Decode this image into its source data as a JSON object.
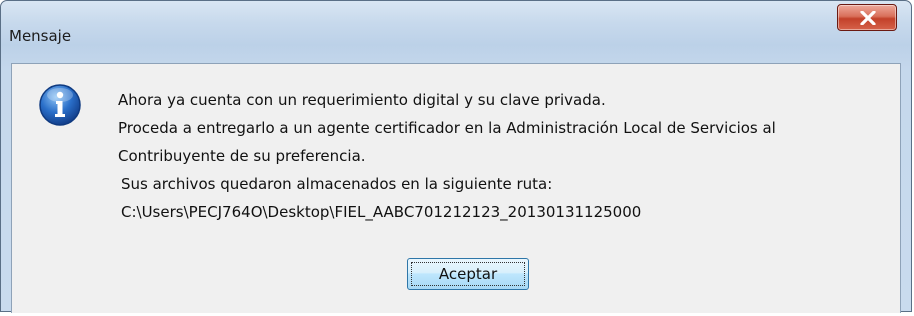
{
  "window": {
    "title": "Mensaje",
    "close_icon": "close-x-icon"
  },
  "message": {
    "icon": "information-icon",
    "lines": [
      "Ahora ya cuenta con un requerimiento digital y su clave privada.",
      "Proceda a entregarlo a un agente certificador en la Administración Local de Servicios al",
      "Contribuyente de su preferencia.",
      "Sus archivos quedaron almacenados en la siguiente ruta:",
      "C:\\Users\\PECJ764O\\Desktop\\FIEL_AABC701212123_20130131125000"
    ]
  },
  "buttons": {
    "ok_label": "Aceptar"
  },
  "colors": {
    "close_button": "#c3412a",
    "info_icon": "#2a6fc9",
    "ok_button_border": "#2e76a8"
  }
}
